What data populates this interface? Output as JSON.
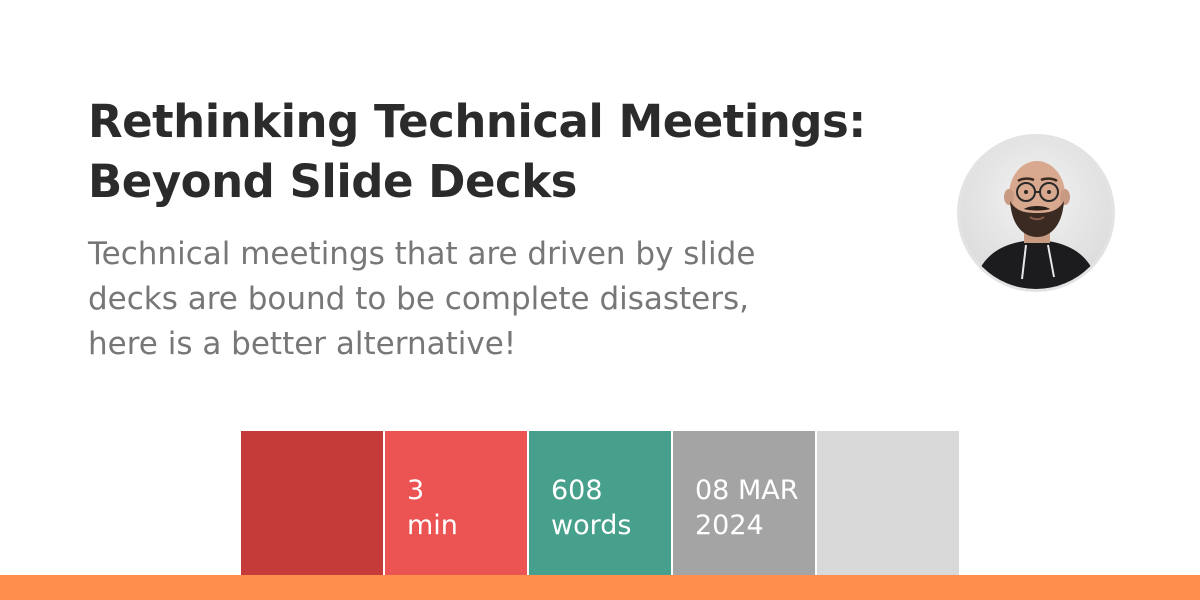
{
  "header": {
    "title_line1": "Rethinking Technical Meetings:",
    "title_line2": "Beyond Slide Decks",
    "subtitle_line1": "Technical meetings that are driven by slide",
    "subtitle_line2": "decks are bound to be complete disasters,",
    "subtitle_line3": "here is a better alternative!"
  },
  "stats": {
    "reading_time": {
      "value": "3",
      "unit": "min"
    },
    "word_count": {
      "value": "608",
      "unit": "words"
    },
    "date": {
      "day_month": "08 MAR",
      "year": "2024"
    }
  },
  "colors": {
    "title": "#2b2b2b",
    "subtitle": "#777777",
    "block_dark_red": "#c43b39",
    "block_red": "#ec5454",
    "block_teal": "#46a08c",
    "block_gray": "#a4a4a4",
    "block_light_gray": "#d9d9d9",
    "bottom_bar": "#ff8f4b"
  },
  "icons": {
    "avatar": "author-portrait"
  }
}
